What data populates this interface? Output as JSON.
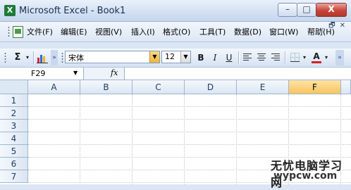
{
  "window": {
    "title": "Microsoft Excel - Book1",
    "app_icon_letter": "X",
    "controls": {
      "minimize": "–",
      "maximize": "□",
      "close": "X"
    }
  },
  "menu": {
    "items": [
      {
        "label": "文件(F)"
      },
      {
        "label": "编辑(E)"
      },
      {
        "label": "视图(V)"
      },
      {
        "label": "插入(I)"
      },
      {
        "label": "格式(O)"
      },
      {
        "label": "工具(T)"
      },
      {
        "label": "数据(D)"
      },
      {
        "label": "窗口(W)"
      },
      {
        "label": "帮助(H)"
      }
    ],
    "mdi_controls": {
      "minimize": "_",
      "restore": "🗗",
      "close": "✕"
    }
  },
  "toolbar": {
    "autosum": "Σ",
    "font_name": "宋体",
    "font_size": "12",
    "bold": "B",
    "italic": "I",
    "underline": "U",
    "font_color_letter": "A",
    "accent_color": "#d62020"
  },
  "formula_bar": {
    "name_box": "F29",
    "fx_label": "fx",
    "formula": ""
  },
  "grid": {
    "columns": [
      "A",
      "B",
      "C",
      "D",
      "E",
      "F"
    ],
    "selected_column": "F",
    "rows": [
      "1",
      "2",
      "3",
      "4",
      "5",
      "6",
      "7"
    ]
  },
  "watermark": {
    "line1": "无忧电脑学习网",
    "line2": "wypcw.com"
  }
}
